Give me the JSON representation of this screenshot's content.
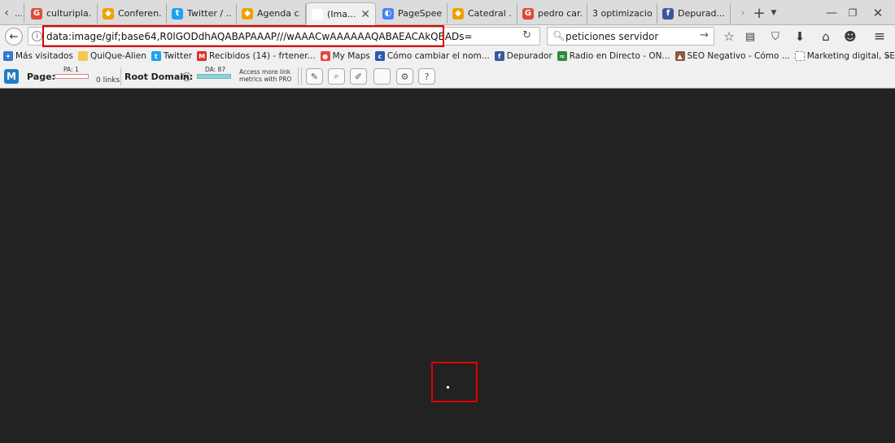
{
  "tabs": [
    {
      "label": "culturipla...",
      "icon": "google-icon",
      "color": "#dd4b39"
    },
    {
      "label": "Conferen...",
      "icon": "site-icon",
      "color": "#f0a000"
    },
    {
      "label": "Twitter / ...",
      "icon": "twitter-icon",
      "color": "#1da1f2"
    },
    {
      "label": "Agenda c...",
      "icon": "site-icon",
      "color": "#f0a000"
    },
    {
      "label": "(Ima...",
      "icon": "blank-page-icon",
      "color": "#ffffff"
    },
    {
      "label": "PageSpee...",
      "icon": "pagespeed-icon",
      "color": "#4285f4"
    },
    {
      "label": "Catedral ...",
      "icon": "site-icon",
      "color": "#f0a000"
    },
    {
      "label": "pedro car...",
      "icon": "google-icon",
      "color": "#dd4b39"
    },
    {
      "label": "3 optimizacio...",
      "icon": "none",
      "color": "#dcdcdc"
    },
    {
      "label": "Depurad...",
      "icon": "facebook-icon",
      "color": "#3b5998"
    }
  ],
  "address": {
    "url": "data:image/gif;base64,R0lGODdhAQABAPAAAP///wAAACwAAAAAAQABAEACAkQBADs="
  },
  "search": {
    "value": "peticiones servidor"
  },
  "bookmarks": [
    {
      "label": "Más visitados",
      "icon": "most-visited-icon",
      "color": "#3c78c8"
    },
    {
      "label": "QuiQue-Alien",
      "icon": "folder-icon",
      "color": "#f2c94c"
    },
    {
      "label": "Twitter",
      "icon": "twitter-icon",
      "color": "#1da1f2"
    },
    {
      "label": "Recibidos (14) - frtener...",
      "icon": "gmail-icon",
      "color": "#d93025"
    },
    {
      "label": "My Maps",
      "icon": "maps-icon",
      "color": "#e8453c"
    },
    {
      "label": "Cómo cambiar el nom...",
      "icon": "clr-icon",
      "color": "#2b5aa8"
    },
    {
      "label": "Depurador",
      "icon": "facebook-icon",
      "color": "#3b5998"
    },
    {
      "label": "Radio en Directo - ON...",
      "icon": "radio-icon",
      "color": "#2f8a3a"
    },
    {
      "label": "SEO Negativo - Cómo ...",
      "icon": "seo-icon",
      "color": "#8a5a3a"
    },
    {
      "label": "Marketing digital, SEO ...",
      "icon": "page-icon",
      "color": "#ffffff"
    }
  ],
  "seo": {
    "page_label": "Page:",
    "pa": "PA: 1",
    "links": "0 links",
    "root_label": "Root Domain:",
    "da": "DA: 87",
    "pro_line1": "Access more link",
    "pro_line2": "metrics with PRO"
  }
}
